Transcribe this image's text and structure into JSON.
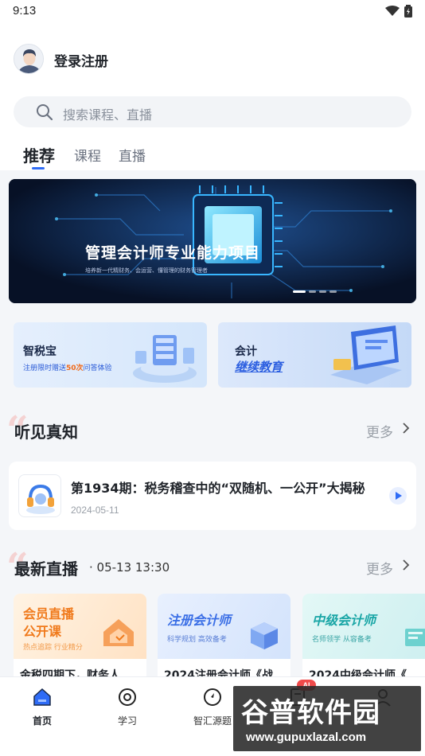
{
  "status_bar": {
    "time": "9:13"
  },
  "header": {
    "login_label": "登录注册",
    "search_placeholder": "搜索课程、直播",
    "tabs": [
      {
        "label": "推荐",
        "active": true
      },
      {
        "label": "课程",
        "active": false
      },
      {
        "label": "直播",
        "active": false
      }
    ]
  },
  "banner": {
    "title": "管理会计师专业能力项目",
    "subtitle": "培养新一代精财务、会运营、懂管理的财务管理者",
    "slide_count": 4,
    "active_slide": 1
  },
  "promos": [
    {
      "title": "智税宝",
      "subtitle_pre": "注册限时赠送",
      "subtitle_highlight": "50次",
      "subtitle_post": "问答体验"
    },
    {
      "title": "会计",
      "subtitle": "继续教育"
    }
  ],
  "podcast_section": {
    "title": "听见真知",
    "more_label": "更多",
    "item": {
      "title": "第1934期：税务稽查中的“双随机、一公开”大揭秘",
      "date": "2024-05-11"
    }
  },
  "live_section": {
    "title": "最新直播",
    "time": "· 05-13 13:30",
    "more_label": "更多",
    "cards": [
      {
        "cover_line1": "会员直播",
        "cover_line2": "公开课",
        "cover_sub": "热点追踪 行业精分",
        "caption": "金税四期下，财务人"
      },
      {
        "cover_line1": "注册会计师",
        "cover_sub": "科学规划 高效备考",
        "caption": "2024注册会计师《战"
      },
      {
        "cover_line1": "中级会计师",
        "cover_sub": "名师领学 从容备考",
        "caption": "2024中级会计师《"
      }
    ]
  },
  "bottom_nav": {
    "items": [
      {
        "label": "首页",
        "icon": "home-icon",
        "active": true
      },
      {
        "label": "学习",
        "icon": "learn-icon",
        "active": false
      },
      {
        "label": "智汇源题",
        "icon": "compass-icon",
        "active": false
      },
      {
        "label": "",
        "icon": "question-bank-icon",
        "active": false
      },
      {
        "label": "",
        "icon": "profile-icon",
        "active": false
      }
    ],
    "ai_badge": "AI"
  },
  "watermark": {
    "line1": "谷普软件园",
    "line2": "www.gupuxlazal.com"
  },
  "colors": {
    "accent": "#2f6cf6",
    "orange": "#f07a1c",
    "badge": "#f04a4a"
  }
}
